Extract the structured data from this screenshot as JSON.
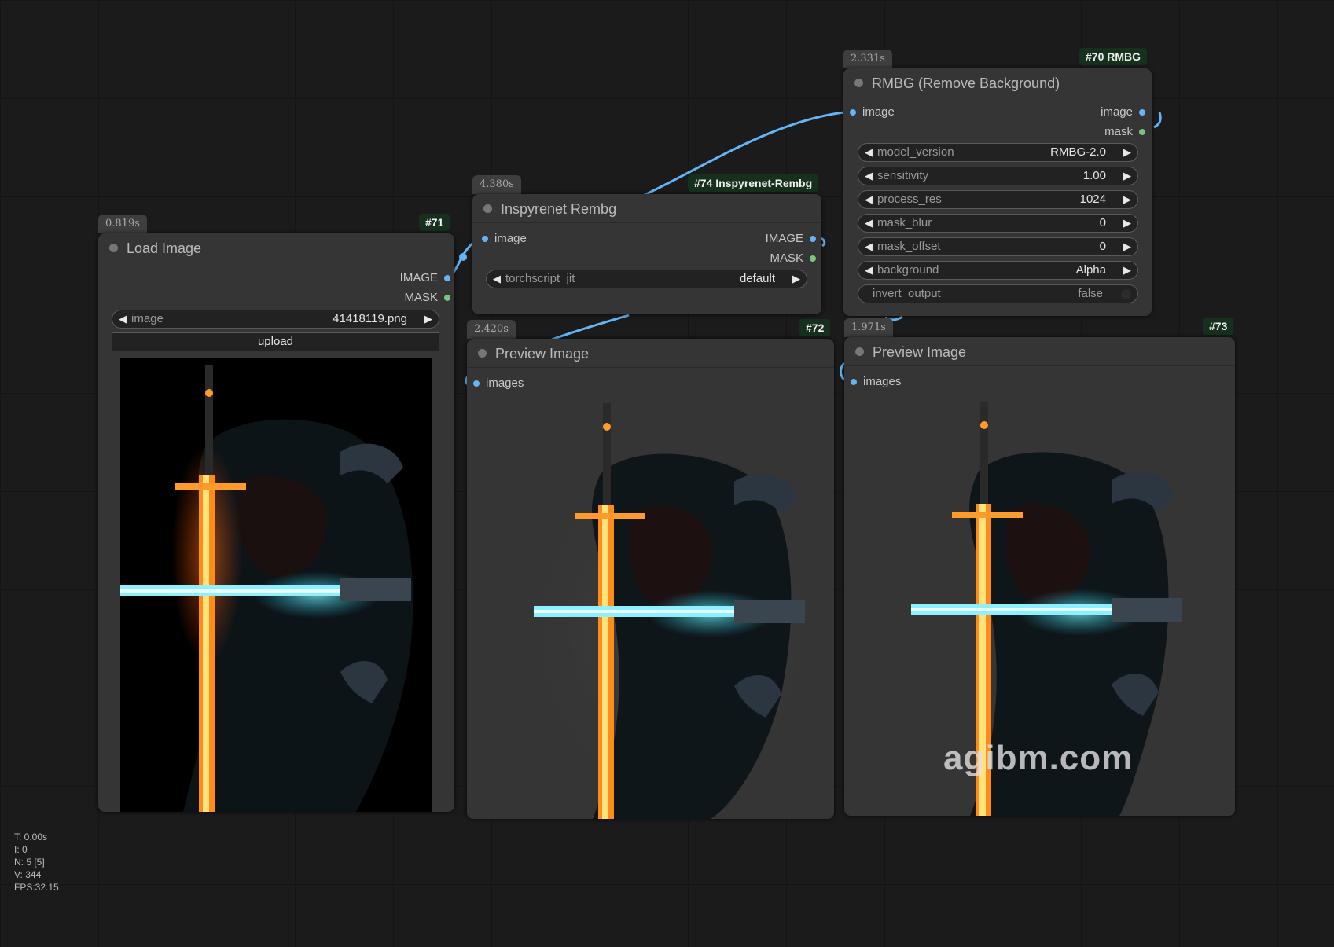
{
  "colors": {
    "canvas": "#1b1b1b",
    "node_bg": "#353535",
    "image_link": "#64b5f6",
    "mask_link": "#7bc47f",
    "id_badge": "#17301d"
  },
  "nodes": {
    "load_image": {
      "id": "#71",
      "time": "0.819s",
      "title": "Load Image",
      "outputs": [
        "IMAGE",
        "MASK"
      ],
      "widget": {
        "name": "image",
        "value": "41418119.png"
      },
      "upload_label": "upload"
    },
    "inspyrenet": {
      "id": "#74 Inspyrenet-Rembg",
      "time": "4.380s",
      "title": "Inspyrenet Rembg",
      "input": "image",
      "outputs": [
        "IMAGE",
        "MASK"
      ],
      "widget": {
        "name": "torchscript_jit",
        "value": "default"
      }
    },
    "rmbg": {
      "id": "#70 RMBG",
      "time": "2.331s",
      "title": "RMBG (Remove Background)",
      "input": "image",
      "outputs": [
        "image",
        "mask"
      ],
      "widgets": [
        {
          "name": "model_version",
          "value": "RMBG-2.0"
        },
        {
          "name": "sensitivity",
          "value": "1.00"
        },
        {
          "name": "process_res",
          "value": "1024"
        },
        {
          "name": "mask_blur",
          "value": "0"
        },
        {
          "name": "mask_offset",
          "value": "0"
        },
        {
          "name": "background",
          "value": "Alpha"
        }
      ],
      "toggle": {
        "name": "invert_output",
        "value": "false"
      }
    },
    "preview_72": {
      "id": "#72",
      "time": "2.420s",
      "title": "Preview Image",
      "input": "images"
    },
    "preview_73": {
      "id": "#73",
      "time": "1.971s",
      "title": "Preview Image",
      "input": "images"
    }
  },
  "stats": {
    "t": "T: 0.00s",
    "i": "I: 0",
    "n": "N: 5 [5]",
    "v": "V: 344",
    "fps": "FPS:32.15"
  },
  "watermark": "agibm.com"
}
